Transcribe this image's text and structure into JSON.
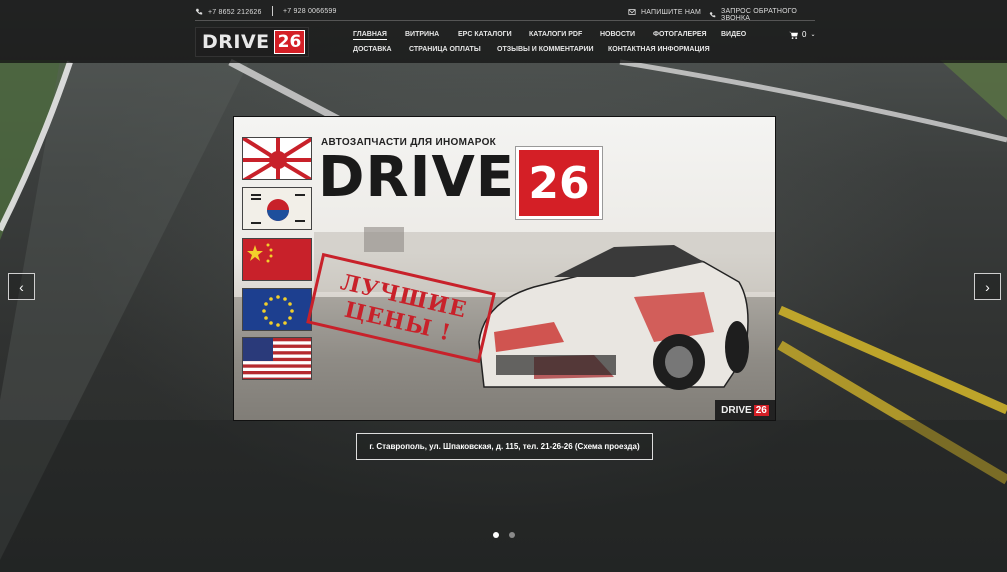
{
  "header": {
    "phones": [
      "+7 8652 212626",
      "+7 928 0066599"
    ],
    "write_us": "НАПИШИТЕ НАМ",
    "callback": "ЗАПРОС ОБРАТНОГО ЗВОНКА",
    "logo_word": "DRIVE",
    "logo_num": "26",
    "nav_row1": [
      {
        "label": "ГЛАВНАЯ",
        "active": true
      },
      {
        "label": "ВИТРИНА"
      },
      {
        "label": "EPC КАТАЛОГИ"
      },
      {
        "label": "КАТАЛОГИ PDF"
      },
      {
        "label": "НОВОСТИ"
      },
      {
        "label": "ФОТОГАЛЕРЕЯ"
      },
      {
        "label": "ВИДЕО"
      }
    ],
    "nav_row2": [
      {
        "label": "ДОСТАВКА"
      },
      {
        "label": "СТРАНИЦА ОПЛАТЫ"
      },
      {
        "label": "ОТЗЫВЫ И КОММЕНТАРИИ"
      },
      {
        "label": "КОНТАКТНАЯ ИНФОРМАЦИЯ"
      }
    ],
    "cart_count": "0"
  },
  "slide": {
    "kicker": "АВТОЗАПЧАСТИ ДЛЯ ИНОМАРОК",
    "title_word": "DRIVE",
    "title_num": "26",
    "stamp_line1": "ЛУЧШИЕ",
    "stamp_line2": "ЦЕНЫ !",
    "badge_word": "DRIVE",
    "badge_num": "26"
  },
  "address": "г. Ставрополь, ул. Шпаковская, д. 115, тел. 21-26-26 (Схема проезда)",
  "slider": {
    "prev": "‹",
    "next": "›",
    "slides_total": 2,
    "active_slide": 1
  },
  "colors": {
    "brand_red": "#d41f26",
    "header_bg": "#141414"
  }
}
